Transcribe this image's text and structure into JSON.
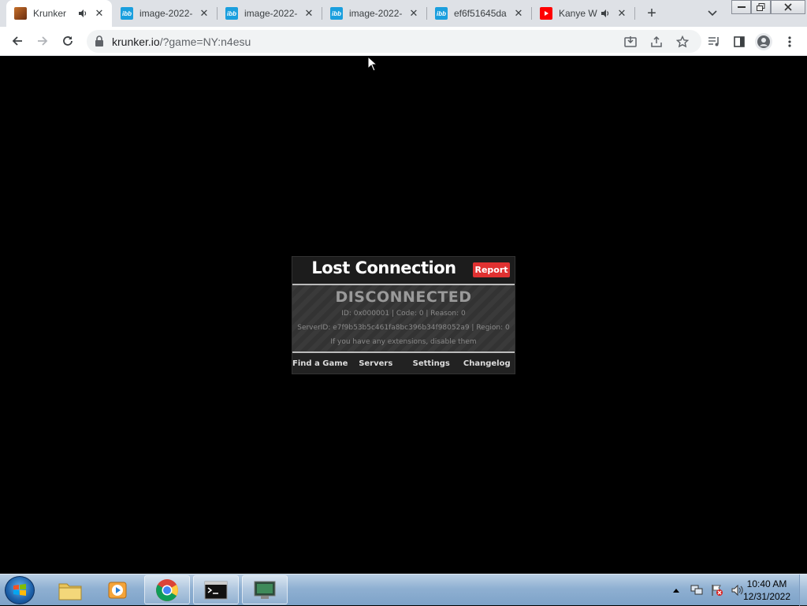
{
  "browser": {
    "tabs": [
      {
        "title": "Krunker",
        "favicon": "krunker-favicon",
        "audio": true,
        "active": true
      },
      {
        "title": "image-2022-",
        "favicon": "ibb-favicon",
        "audio": false,
        "active": false
      },
      {
        "title": "image-2022-",
        "favicon": "ibb-favicon",
        "audio": false,
        "active": false
      },
      {
        "title": "image-2022-",
        "favicon": "ibb-favicon",
        "audio": false,
        "active": false
      },
      {
        "title": "ef6f51645da",
        "favicon": "ibb-favicon",
        "audio": false,
        "active": false
      },
      {
        "title": "Kanye W",
        "favicon": "youtube-favicon",
        "audio": true,
        "active": false
      }
    ],
    "ibb_label": "ibb",
    "new_tab_label": "+",
    "url_host": "krunker.io",
    "url_path": "/?game=NY:n4esu"
  },
  "dialog": {
    "title": "Lost Connection",
    "report_label": "Report",
    "status": "DISCONNECTED",
    "id_line": "ID: 0x000001 | Code: 0 | Reason: 0",
    "server_line": "ServerID: e7f9b53b5c461fa8bc396b34f98052a9 | Region: 0",
    "hint_line": "If you have any extensions, disable them",
    "footer": [
      "Find a Game",
      "Servers",
      "Settings",
      "Changelog"
    ]
  },
  "taskbar": {
    "time": "10:40 AM",
    "date": "12/31/2022"
  },
  "colors": {
    "tabstrip_bg": "#dee1e6",
    "report_red": "#e03131",
    "dialog_bg": "#222222",
    "page_bg": "#000000"
  }
}
